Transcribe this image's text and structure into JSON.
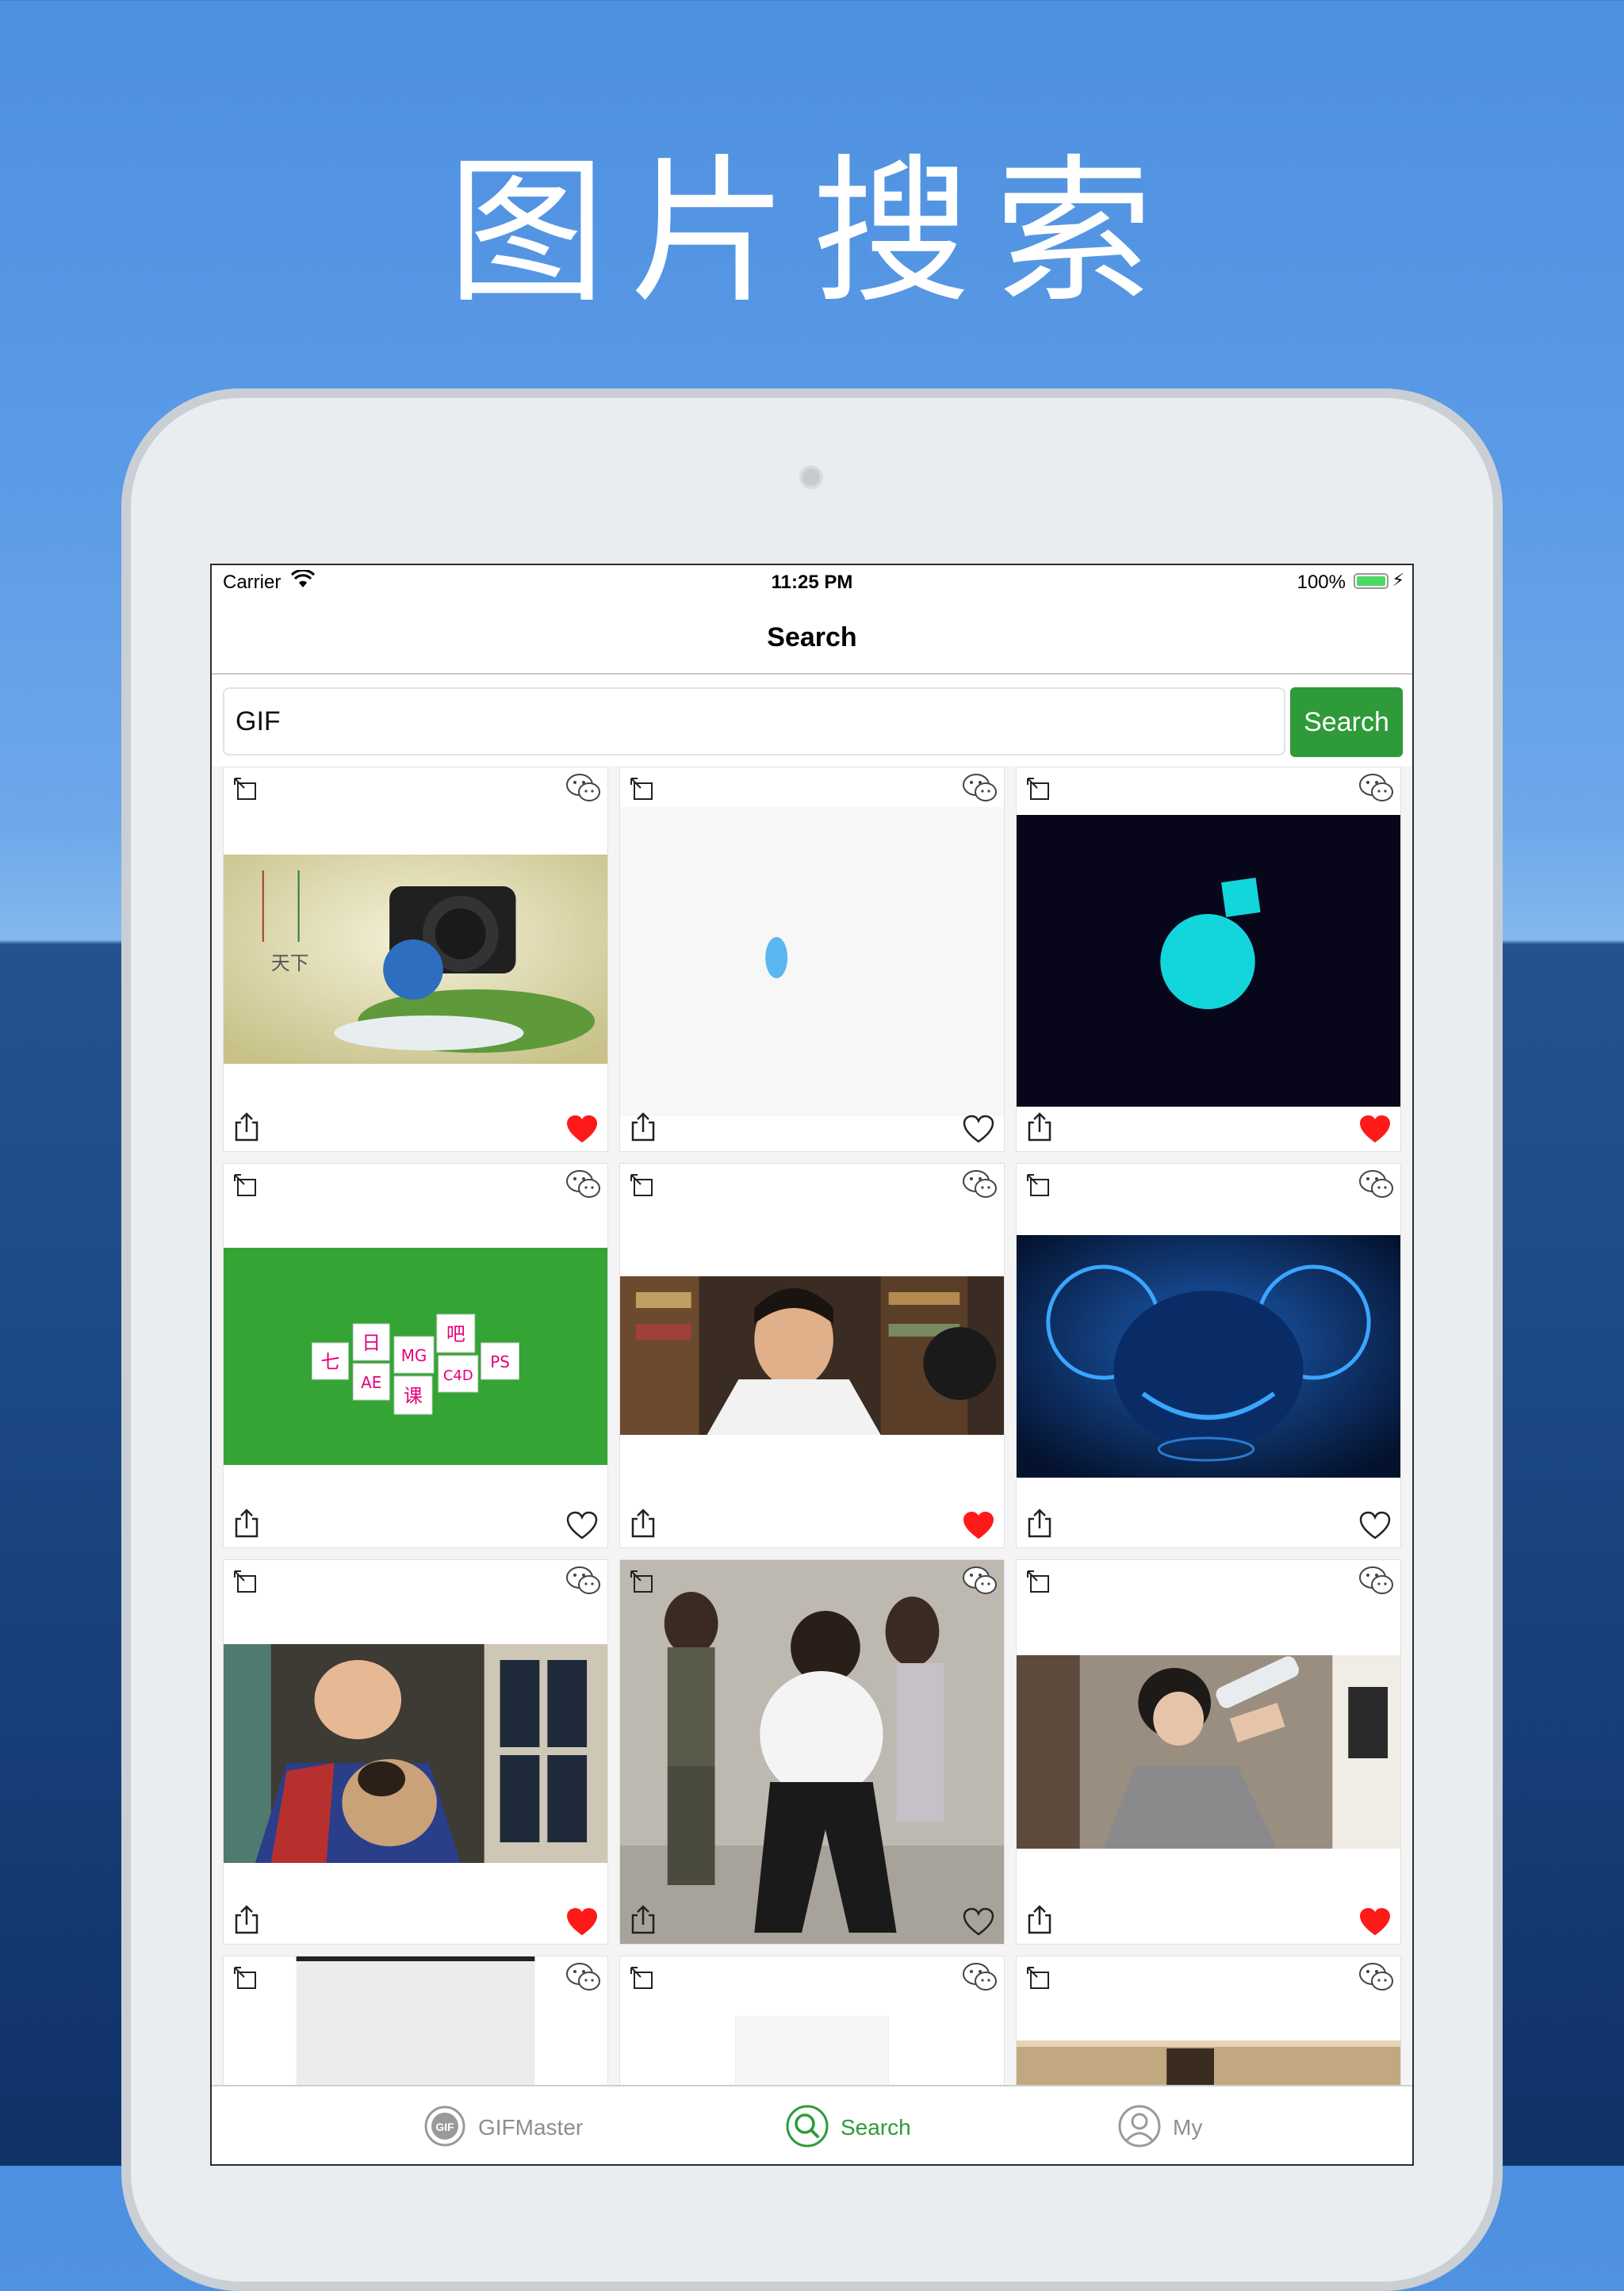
{
  "headline": "图片搜索",
  "status_bar": {
    "carrier": "Carrier",
    "time": "11:25 PM",
    "battery": "100%"
  },
  "nav": {
    "title": "Search"
  },
  "search": {
    "value": "GIF",
    "button_label": "Search"
  },
  "colors": {
    "accent": "#2f9a3a",
    "heart_active": "#ff1a1a"
  },
  "cards": [
    {
      "liked": true,
      "thumb": "camera-scene"
    },
    {
      "liked": false,
      "thumb": "loading-blob"
    },
    {
      "liked": true,
      "thumb": "music-logo"
    },
    {
      "liked": false,
      "thumb": "green-tiles"
    },
    {
      "liked": true,
      "thumb": "man-portrait"
    },
    {
      "liked": false,
      "thumb": "mouse-helmet"
    },
    {
      "liked": true,
      "thumb": "man-with-dog"
    },
    {
      "liked": false,
      "thumb": "dancing-girls"
    },
    {
      "liked": true,
      "thumb": "woman-drinking"
    },
    {
      "liked": false,
      "thumb": "grey-blank"
    },
    {
      "liked": false,
      "thumb": "white-blank"
    },
    {
      "liked": false,
      "thumb": "doorway"
    }
  ],
  "tiles_text": {
    "t1": "七",
    "t2": "日",
    "t3": "MG",
    "t4": "吧",
    "t5": "AE",
    "t6": "课",
    "t7": "C4D",
    "t8": "PS"
  },
  "camera_text": {
    "t1": "天下"
  },
  "tabs": [
    {
      "label": "GIFMaster",
      "icon": "gif-icon"
    },
    {
      "label": "Search",
      "icon": "search-icon"
    },
    {
      "label": "My",
      "icon": "user-icon"
    }
  ]
}
